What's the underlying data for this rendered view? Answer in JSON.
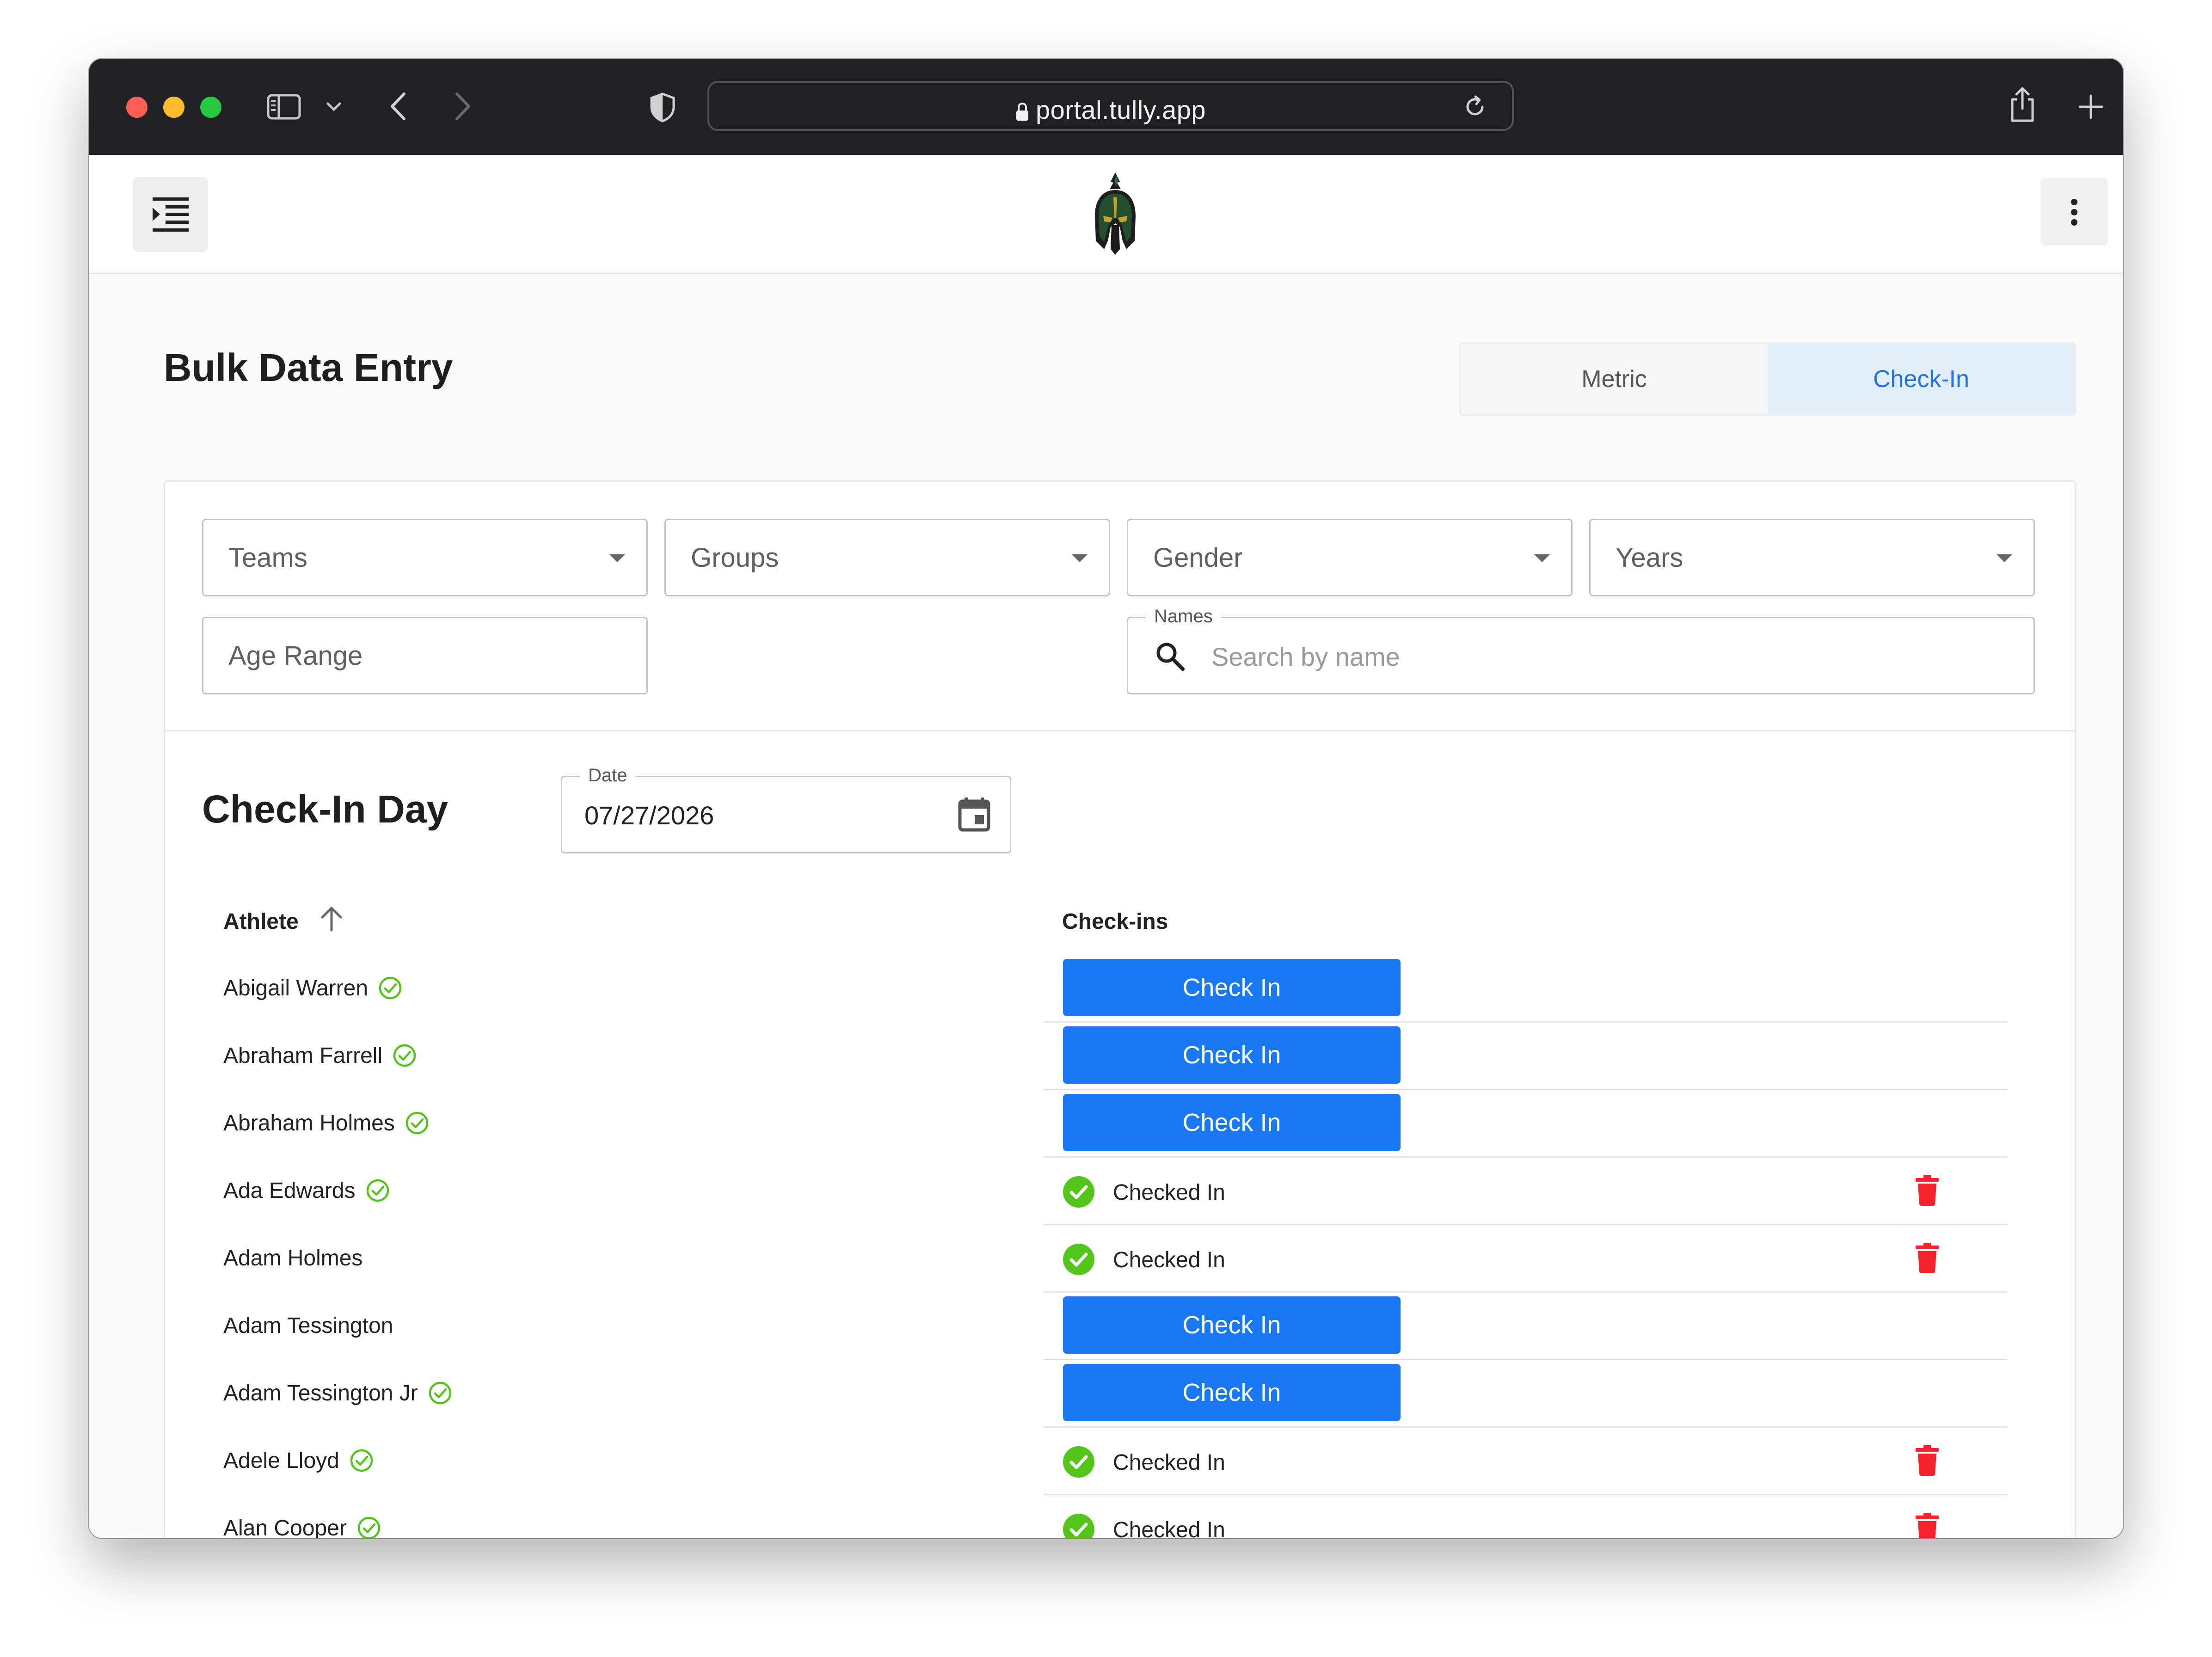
{
  "browser": {
    "url": "portal.tully.app"
  },
  "page": {
    "title": "Bulk Data Entry",
    "mode_toggle": [
      {
        "label": "Metric",
        "active": false
      },
      {
        "label": "Check-In",
        "active": true
      }
    ]
  },
  "filters": {
    "teams": "Teams",
    "groups": "Groups",
    "gender": "Gender",
    "years": "Years",
    "age_range": "Age Range",
    "names_label": "Names",
    "names_placeholder": "Search by name"
  },
  "checkin": {
    "heading": "Check-In Day",
    "date_label": "Date",
    "date_value": "07/27/2026"
  },
  "table": {
    "col_athlete": "Athlete",
    "col_checkins": "Check-ins",
    "check_in_label": "Check In",
    "checked_in_label": "Checked In",
    "rows": [
      {
        "name": "Abigail Warren",
        "verified": true,
        "checked_in": false
      },
      {
        "name": "Abraham Farrell",
        "verified": true,
        "checked_in": false
      },
      {
        "name": "Abraham Holmes",
        "verified": true,
        "checked_in": false
      },
      {
        "name": "Ada Edwards",
        "verified": true,
        "checked_in": true
      },
      {
        "name": "Adam Holmes",
        "verified": false,
        "checked_in": true
      },
      {
        "name": "Adam Tessington",
        "verified": false,
        "checked_in": false
      },
      {
        "name": "Adam Tessington Jr",
        "verified": true,
        "checked_in": false
      },
      {
        "name": "Adele Lloyd",
        "verified": true,
        "checked_in": true
      },
      {
        "name": "Alan Cooper",
        "verified": true,
        "checked_in": true
      }
    ]
  },
  "colors": {
    "primary": "#1877f2",
    "success": "#52c41a",
    "danger": "#f5222d",
    "toggle_active_bg": "#e3edfa"
  },
  "icons": [
    "sidebar-toggle-icon",
    "chevron-down-icon",
    "back-icon",
    "forward-icon",
    "shield-icon",
    "lock-icon",
    "reload-icon",
    "share-icon",
    "new-tab-icon",
    "tab-overview-icon",
    "menu-expand-icon",
    "spartan-helmet-logo",
    "more-vertical-icon",
    "search-icon",
    "calendar-icon",
    "arrow-up-icon",
    "verified-icon",
    "check-circle-icon",
    "trash-icon"
  ]
}
